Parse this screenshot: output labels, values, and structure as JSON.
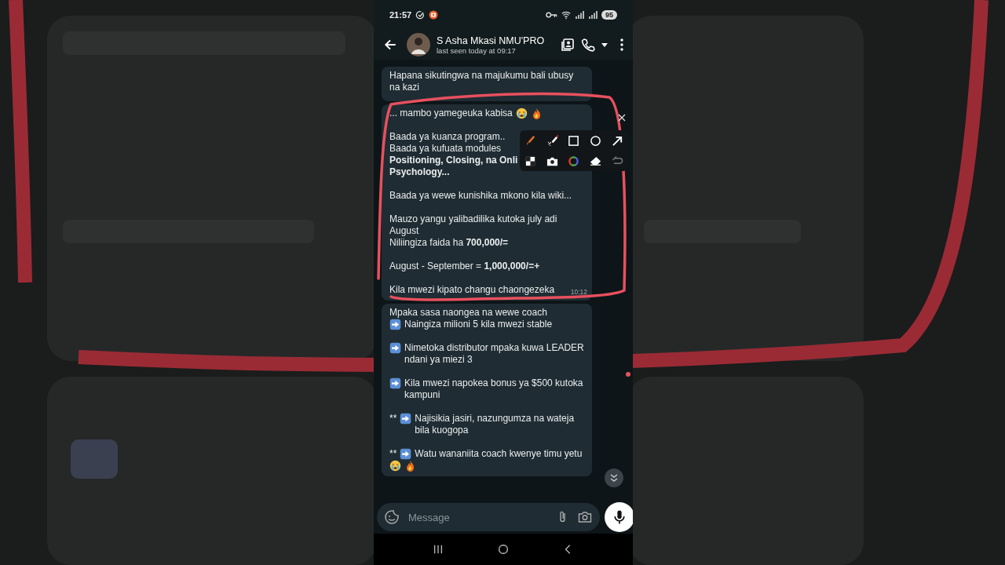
{
  "status_bar": {
    "time": "21:57",
    "battery": "95"
  },
  "header": {
    "name": "S Asha Mkasi NMU'PRO",
    "last_seen": "last seen today at 09:17"
  },
  "messages": [
    {
      "paragraphs": [
        [
          {
            "kind": "plain",
            "text": "Hapana sikutingwa na majukumu bali ubusy na kazi"
          }
        ]
      ]
    },
    {
      "time": "10:12",
      "paragraphs": [
        [
          {
            "kind": "emoji_end",
            "text": "... mambo yamegeuka kabisa"
          }
        ],
        [
          {
            "kind": "plain",
            "text": "Baada ya kuanza program.."
          },
          {
            "kind": "plain",
            "text": "Baada ya kufuata modules"
          },
          {
            "kind": "plain",
            "bold": true,
            "text": "Positioning, Closing, na Onli"
          },
          {
            "kind": "plain",
            "bold": true,
            "text": "Psychology..."
          }
        ],
        [
          {
            "kind": "plain",
            "text": "Baada ya wewe kunishika mkono kila wiki..."
          }
        ],
        [
          {
            "kind": "plain",
            "text": "Mauzo yangu yalibadilika kutoka july adi August"
          },
          {
            "kind": "plain",
            "text": "Niliingiza faida ha **700,000/=**"
          }
        ],
        [
          {
            "kind": "plain",
            "text": "August - September = **1,000,000/=+**"
          }
        ],
        [
          {
            "kind": "plain",
            "text": "Kila mwezi kipato changu chaongezeka"
          }
        ]
      ]
    },
    {
      "paragraphs": [
        [
          {
            "kind": "plain",
            "text": "Mpaka sasa naongea na wewe coach"
          },
          {
            "kind": "arrow",
            "text": "Naingiza milioni 5 kila mwezi stable"
          }
        ],
        [
          {
            "kind": "arrow",
            "text": "Nimetoka distributor mpaka kuwa LEADER ndani ya miezi 3"
          }
        ],
        [
          {
            "kind": "arrow",
            "text": "Kila mwezi napokea bonus ya $500 kutoka kampuni"
          }
        ],
        [
          {
            "kind": "arrow",
            "prefix": "**",
            "text": "Najisikia jasiri, nazungumza na wateja bila kuogopa"
          }
        ],
        [
          {
            "kind": "arrow",
            "prefix": "**",
            "text": "Watu wananiita coach kwenye timu yetu"
          },
          {
            "kind": "emojis"
          }
        ]
      ]
    }
  ],
  "composer": {
    "placeholder": "Message"
  }
}
